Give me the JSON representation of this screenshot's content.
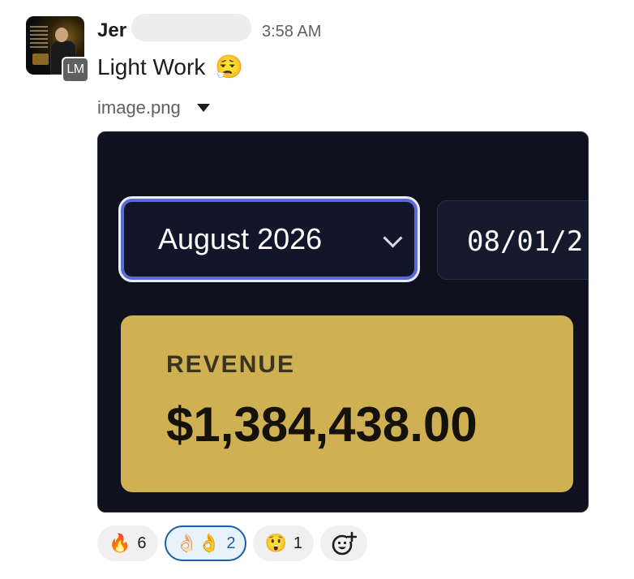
{
  "message": {
    "sender": "Jer",
    "timestamp": "3:58 AM",
    "avatar_badge": "LM",
    "text": "Light Work",
    "text_emoji": "😮‍💨",
    "attachment": {
      "filename": "image.png"
    }
  },
  "screenshot": {
    "month_select": "August 2026",
    "date_input": "08/01/2",
    "revenue_label": "REVENUE",
    "revenue_value": "$1,384,438.00",
    "accent_color": "#5a6bd4",
    "card_color": "#cfb052"
  },
  "reactions": [
    {
      "emoji": "🔥",
      "count": "6"
    },
    {
      "emoji": "👌🏻",
      "emoji2": "👌",
      "count": "2"
    },
    {
      "emoji": "😲",
      "count": "1"
    }
  ],
  "add_reaction_icon": "add-reaction-icon"
}
